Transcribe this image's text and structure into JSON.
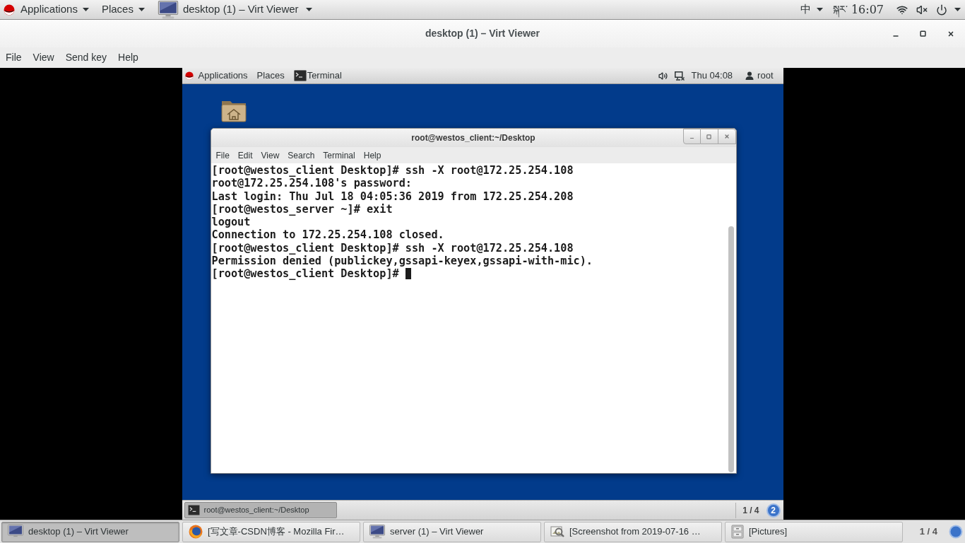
{
  "top_bar": {
    "menus": [
      "Applications",
      "Places"
    ],
    "window_menu": "desktop (1) – Virt Viewer",
    "input_method": "中",
    "clock_label": "སྐར་",
    "clock": "16:07"
  },
  "window": {
    "title": "desktop (1) – Virt Viewer",
    "menu": [
      "File",
      "View",
      "Send key",
      "Help"
    ]
  },
  "guest": {
    "top_bar": {
      "menus": [
        "Applications",
        "Places"
      ],
      "app": "Terminal",
      "clock": "Thu 04:08",
      "user": "root"
    },
    "terminal": {
      "title": "root@westos_client:~/Desktop",
      "menu": [
        "File",
        "Edit",
        "View",
        "Search",
        "Terminal",
        "Help"
      ],
      "lines": [
        "[root@westos_client Desktop]# ssh -X root@172.25.254.108",
        "root@172.25.254.108's password:",
        "Last login: Thu Jul 18 04:05:36 2019 from 172.25.254.208",
        "[root@westos_server ~]# exit",
        "logout",
        "Connection to 172.25.254.108 closed.",
        "[root@westos_client Desktop]# ssh -X root@172.25.254.108",
        "Permission denied (publickey,gssapi-keyex,gssapi-with-mic).",
        "[root@westos_client Desktop]#"
      ]
    },
    "bottom_bar": {
      "tasks": [
        {
          "label": "root@westos_client:~/Desktop",
          "selected": true
        }
      ],
      "workspace": "1 / 4",
      "notifications": "2"
    }
  },
  "taskbar": {
    "tasks": [
      {
        "kind": "viewer",
        "label": "desktop (1) – Virt Viewer",
        "selected": true
      },
      {
        "kind": "browser",
        "label": "[写文章-CSDN博客 - Mozilla Fir…",
        "selected": false
      },
      {
        "kind": "viewer",
        "label": "server (1) – Virt Viewer",
        "selected": false
      },
      {
        "kind": "image",
        "label": "[Screenshot from 2019-07-16 …",
        "selected": false
      },
      {
        "kind": "files",
        "label": "[Pictures]",
        "selected": false
      }
    ],
    "workspace": "1 / 4"
  }
}
